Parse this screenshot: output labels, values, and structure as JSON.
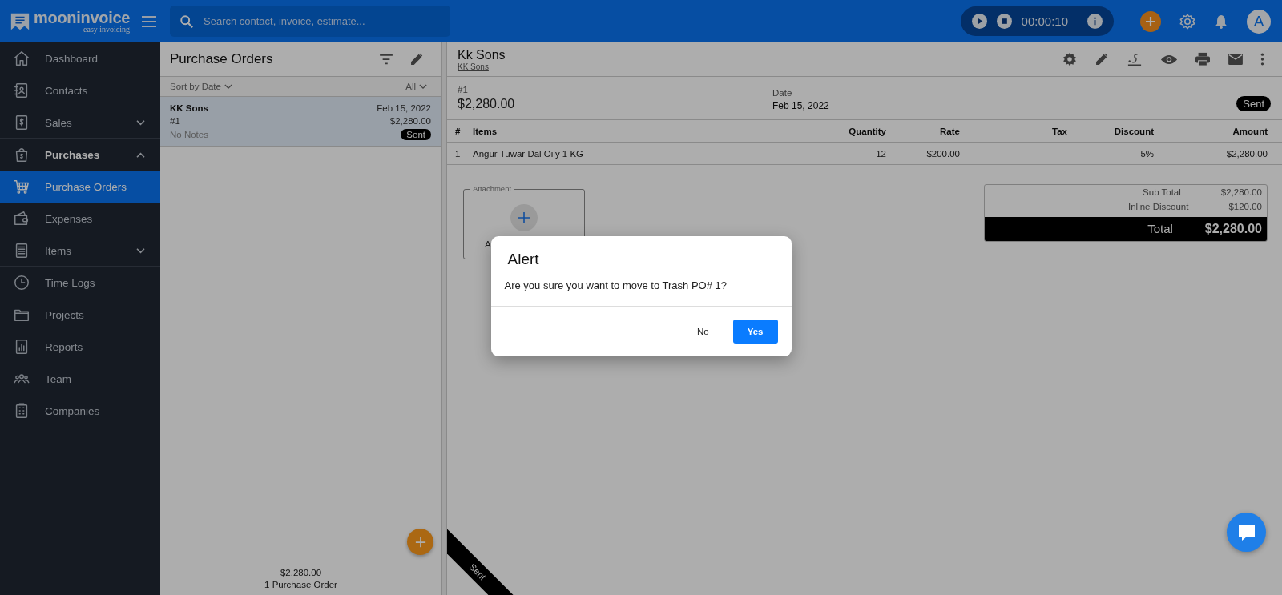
{
  "app": {
    "logo_name": "mooninvoice",
    "logo_tagline": "easy invoicing"
  },
  "search": {
    "placeholder": "Search contact, invoice, estimate..."
  },
  "timer": {
    "time": "00:00:10"
  },
  "avatar": {
    "initial": "A"
  },
  "sidebar": {
    "items": [
      {
        "label": "Dashboard",
        "selected": false
      },
      {
        "label": "Contacts",
        "selected": false
      },
      {
        "label": "Sales",
        "selected": false,
        "expanded": false
      },
      {
        "label": "Purchases",
        "selected": false,
        "expanded": true
      },
      {
        "label": "Purchase Orders",
        "selected": true
      },
      {
        "label": "Expenses",
        "selected": false
      },
      {
        "label": "Items",
        "selected": false,
        "expanded": false
      },
      {
        "label": "Time Logs",
        "selected": false
      },
      {
        "label": "Projects",
        "selected": false
      },
      {
        "label": "Reports",
        "selected": false
      },
      {
        "label": "Team",
        "selected": false
      },
      {
        "label": "Companies",
        "selected": false
      }
    ]
  },
  "list": {
    "title": "Purchase Orders",
    "sort": "Sort by Date",
    "filter": "All",
    "orders": [
      {
        "customer": "KK Sons",
        "date": "Feb 15, 2022",
        "number": "#1",
        "amount": "$2,280.00",
        "notes": "No Notes",
        "status": "Sent",
        "selected": true
      }
    ],
    "footer_total": "$2,280.00",
    "footer_count": "1 Purchase Order"
  },
  "detail": {
    "title": "Kk Sons",
    "contact_link": "KK Sons",
    "number": "#1",
    "amount": "$2,280.00",
    "date_label": "Date",
    "date": "Feb 15, 2022",
    "status": "Sent",
    "columns": [
      "#",
      "Items",
      "Quantity",
      "Rate",
      "Tax",
      "Discount",
      "Amount"
    ],
    "rows": [
      {
        "no": "1",
        "item": "Angur Tuwar Dal Oily 1 KG",
        "quantity": "12",
        "rate": "$200.00",
        "discount": "5%",
        "amount": "$2,280.00"
      }
    ],
    "attachment_legend": "Attachment",
    "attachment_label": "A",
    "summary": [
      {
        "label": "Sub Total",
        "value": "$2,280.00"
      },
      {
        "label": "Inline Discount",
        "value": "$120.00"
      }
    ],
    "total": {
      "label": "Total",
      "value": "$2,280.00"
    },
    "ribbon": "Sent"
  },
  "dialog": {
    "title": "Alert",
    "message": "Are you sure you want to move to Trash PO# 1?",
    "buttons": [
      {
        "label": "No",
        "kind": "secondary"
      },
      {
        "label": "Yes",
        "kind": "primary"
      }
    ]
  }
}
